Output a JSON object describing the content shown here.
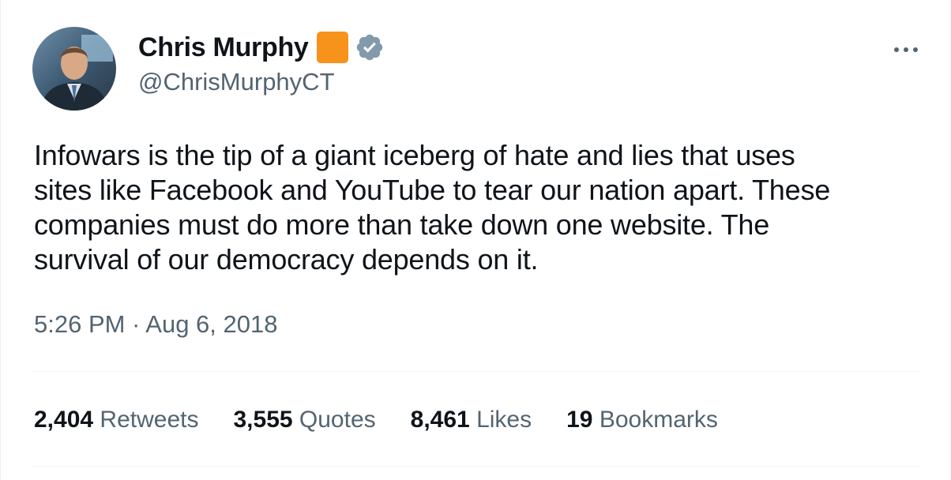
{
  "author": {
    "display_name": "Chris Murphy",
    "handle": "@ChrisMurphyCT",
    "badge_color": "#f7931a",
    "verified_color": "#829aab"
  },
  "tweet": {
    "lines": [
      "Infowars is the tip of a giant iceberg of hate and lies that uses",
      "sites like Facebook and YouTube to tear our nation apart. These",
      "companies must do more than take down one website. The",
      "survival of our democracy depends on it."
    ],
    "timestamp": "5:26 PM · Aug 6, 2018"
  },
  "stats": [
    {
      "value": "2,404",
      "label": "Retweets"
    },
    {
      "value": "3,555",
      "label": "Quotes"
    },
    {
      "value": "8,461",
      "label": "Likes"
    },
    {
      "value": "19",
      "label": "Bookmarks"
    }
  ],
  "icons": {
    "more": "more-horizontal-icon",
    "verified": "verified-badge-icon",
    "affiliation": "affiliation-badge-icon"
  }
}
